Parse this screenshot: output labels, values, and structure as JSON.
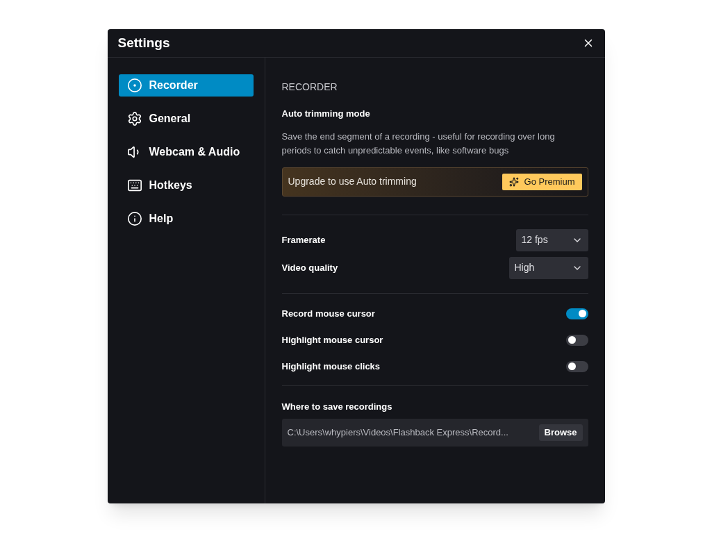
{
  "window": {
    "title": "Settings"
  },
  "sidebar": {
    "items": [
      {
        "label": "Recorder",
        "selected": true
      },
      {
        "label": "General",
        "selected": false
      },
      {
        "label": "Webcam & Audio",
        "selected": false
      },
      {
        "label": "Hotkeys",
        "selected": false
      },
      {
        "label": "Help",
        "selected": false
      }
    ]
  },
  "section_title": "RECORDER",
  "auto_trimming": {
    "title": "Auto trimming mode",
    "description": "Save the end segment of a recording - useful for recording over long periods to catch unpredictable events, like software bugs",
    "banner_text": "Upgrade to use Auto trimming",
    "button": "Go Premium"
  },
  "selects": [
    {
      "label": "Framerate",
      "value": "12 fps"
    },
    {
      "label": "Video quality",
      "value": "High"
    }
  ],
  "toggles": [
    {
      "label": "Record mouse cursor",
      "on": true
    },
    {
      "label": "Highlight mouse cursor",
      "on": false
    },
    {
      "label": "Highlight mouse clicks",
      "on": false
    }
  ],
  "save_location": {
    "label": "Where to save recordings",
    "value": "C:\\Users\\whypiers\\Videos\\Flashback Express\\Record...",
    "button": "Browse"
  }
}
